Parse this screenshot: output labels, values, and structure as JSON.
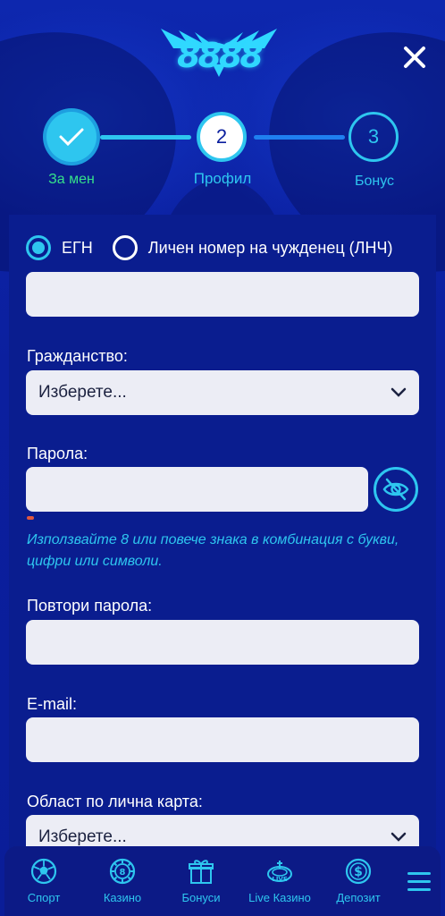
{
  "header": {
    "logo_text": "8888"
  },
  "stepper": {
    "steps": [
      {
        "number": "",
        "label": "За мен",
        "state": "done"
      },
      {
        "number": "2",
        "label": "Профил",
        "state": "active"
      },
      {
        "number": "3",
        "label": "Бонус",
        "state": "upcoming"
      }
    ]
  },
  "form": {
    "id_type": {
      "options": [
        {
          "label": "ЕГН",
          "selected": true
        },
        {
          "label": "Личен номер на чужденец (ЛНЧ)",
          "selected": false
        }
      ],
      "value": ""
    },
    "citizenship": {
      "label": "Гражданство:",
      "value": "Изберете..."
    },
    "password": {
      "label": "Парола:",
      "value": "",
      "hint": "Използвайте 8 или повече знака в комбинация с букви, цифри или символи."
    },
    "repeat_password": {
      "label": "Повтори парола:",
      "value": ""
    },
    "email": {
      "label": "E-mail:",
      "value": ""
    },
    "id_region": {
      "label": "Област по лична карта:",
      "value": "Изберете..."
    }
  },
  "bottom_nav": {
    "items": [
      {
        "label": "Спорт",
        "icon": "soccer-ball-icon"
      },
      {
        "label": "Казино",
        "icon": "casino-chip-icon"
      },
      {
        "label": "Бонуси",
        "icon": "gift-icon"
      },
      {
        "label": "Live Казино",
        "icon": "live-roulette-icon"
      },
      {
        "label": "Депозит",
        "icon": "dollar-coin-icon"
      }
    ],
    "menu_icon": "hamburger-menu-icon"
  },
  "colors": {
    "background": "#0b1f9e",
    "accent": "#2ec6ef",
    "success": "#35e08a",
    "input_bg": "#ecedf5"
  }
}
